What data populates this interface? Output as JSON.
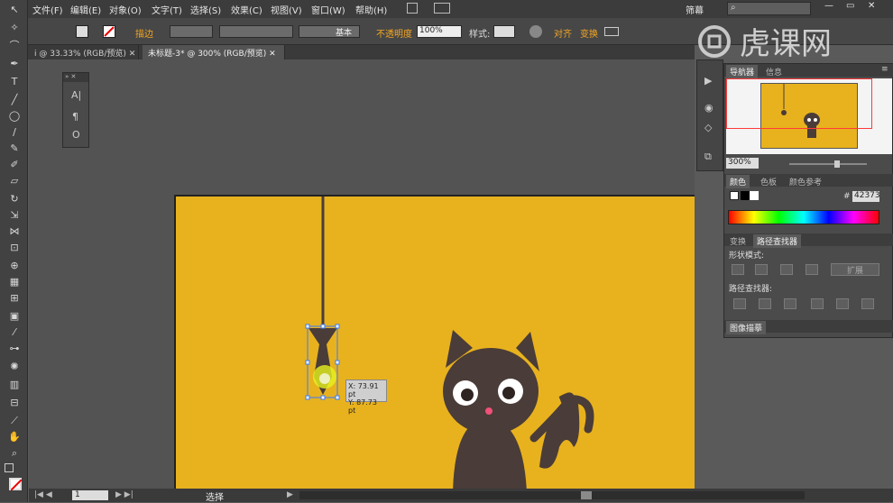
{
  "menu": [
    "文件(F)",
    "编辑(E)",
    "对象(O)",
    "文字(T)",
    "选择(S)",
    "效果(C)",
    "视图(V)",
    "窗口(W)",
    "帮助(H)"
  ],
  "app": {
    "workspace": "筛幕",
    "search_placeholder": "",
    "watermark": "虎课网"
  },
  "controlbar": {
    "stroke_label": "描边",
    "stroke_style": "基本",
    "opacity_label": "不透明度",
    "opacity_value": "100%",
    "style_label": "样式:",
    "align_label": "对齐",
    "transform_label": "变换"
  },
  "doc_tabs": [
    {
      "label": "i @ 33.33% (RGB/预览)",
      "active": false
    },
    {
      "label": "未标题-3* @ 300% (RGB/预览)",
      "active": true
    }
  ],
  "navigator": {
    "tabs": [
      "导航器",
      "信息"
    ],
    "zoom": "300%"
  },
  "color": {
    "tabs": [
      "颜色",
      "色板",
      "颜色参考"
    ],
    "hex": "42373"
  },
  "pathfinder": {
    "tabs": [
      "变换",
      "路径查找器"
    ],
    "shape_modes": "形状模式:",
    "expand": "扩展",
    "pathfinders": "路径查找器:"
  },
  "image_trace": "图像描摹",
  "tooltip": {
    "x": "X: 73.91 pt",
    "y": "Y: 87.73 pt"
  },
  "status": {
    "page": "1",
    "mode": "选择"
  },
  "colors": {
    "artboard": "#e8b21e",
    "cat": "#4a3c38",
    "string": "#4a3c38"
  }
}
